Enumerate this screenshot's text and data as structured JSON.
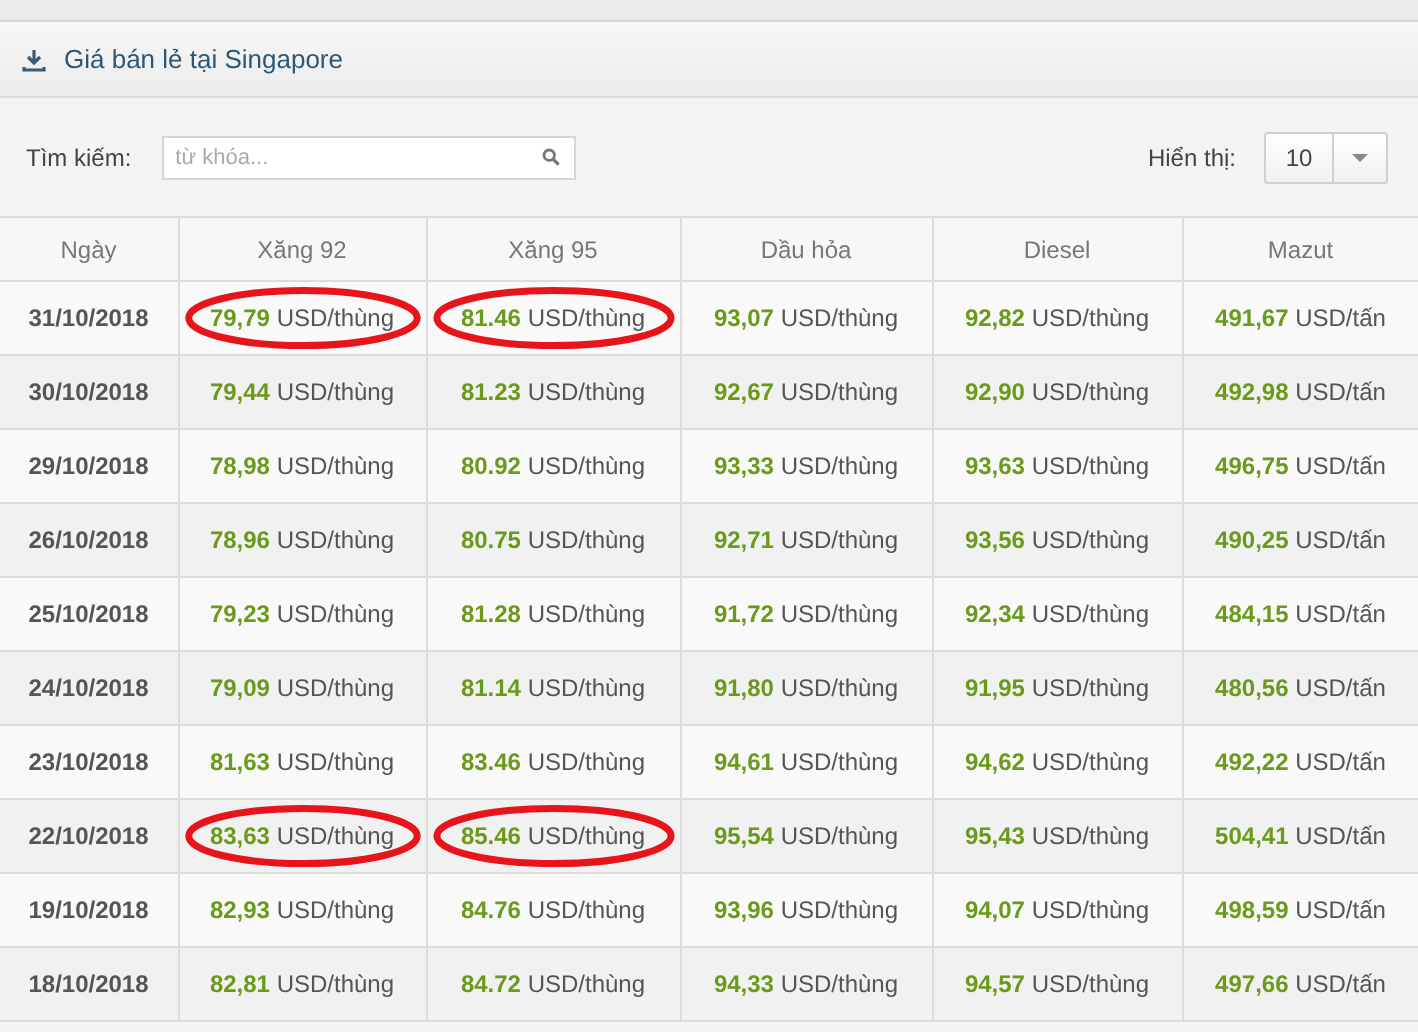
{
  "panel": {
    "title": "Giá bán lẻ tại Singapore"
  },
  "toolbar": {
    "search_label": "Tìm kiếm:",
    "search_placeholder": "từ khóa...",
    "page_size_label": "Hiển thị:",
    "page_size": "10"
  },
  "table": {
    "columns": [
      "Ngày",
      "Xăng 92",
      "Xăng 95",
      "Dầu hỏa",
      "Diesel",
      "Mazut"
    ],
    "rows": [
      {
        "cells": [
          {
            "kind": "date",
            "value": "31/10/2018"
          },
          {
            "kind": "price",
            "value": "79,79",
            "unit": "USD/thùng",
            "circled": true
          },
          {
            "kind": "price",
            "value": "81.46",
            "unit": "USD/thùng",
            "circled": true
          },
          {
            "kind": "price",
            "value": "93,07",
            "unit": "USD/thùng",
            "circled": false
          },
          {
            "kind": "price",
            "value": "92,82",
            "unit": "USD/thùng",
            "circled": false
          },
          {
            "kind": "price",
            "value": "491,67",
            "unit": "USD/tấn",
            "circled": false
          }
        ]
      },
      {
        "cells": [
          {
            "kind": "date",
            "value": "30/10/2018"
          },
          {
            "kind": "price",
            "value": "79,44",
            "unit": "USD/thùng",
            "circled": false
          },
          {
            "kind": "price",
            "value": "81.23",
            "unit": "USD/thùng",
            "circled": false
          },
          {
            "kind": "price",
            "value": "92,67",
            "unit": "USD/thùng",
            "circled": false
          },
          {
            "kind": "price",
            "value": "92,90",
            "unit": "USD/thùng",
            "circled": false
          },
          {
            "kind": "price",
            "value": "492,98",
            "unit": "USD/tấn",
            "circled": false
          }
        ]
      },
      {
        "cells": [
          {
            "kind": "date",
            "value": "29/10/2018"
          },
          {
            "kind": "price",
            "value": "78,98",
            "unit": "USD/thùng",
            "circled": false
          },
          {
            "kind": "price",
            "value": "80.92",
            "unit": "USD/thùng",
            "circled": false
          },
          {
            "kind": "price",
            "value": "93,33",
            "unit": "USD/thùng",
            "circled": false
          },
          {
            "kind": "price",
            "value": "93,63",
            "unit": "USD/thùng",
            "circled": false
          },
          {
            "kind": "price",
            "value": "496,75",
            "unit": "USD/tấn",
            "circled": false
          }
        ]
      },
      {
        "cells": [
          {
            "kind": "date",
            "value": "26/10/2018"
          },
          {
            "kind": "price",
            "value": "78,96",
            "unit": "USD/thùng",
            "circled": false
          },
          {
            "kind": "price",
            "value": "80.75",
            "unit": "USD/thùng",
            "circled": false
          },
          {
            "kind": "price",
            "value": "92,71",
            "unit": "USD/thùng",
            "circled": false
          },
          {
            "kind": "price",
            "value": "93,56",
            "unit": "USD/thùng",
            "circled": false
          },
          {
            "kind": "price",
            "value": "490,25",
            "unit": "USD/tấn",
            "circled": false
          }
        ]
      },
      {
        "cells": [
          {
            "kind": "date",
            "value": "25/10/2018"
          },
          {
            "kind": "price",
            "value": "79,23",
            "unit": "USD/thùng",
            "circled": false
          },
          {
            "kind": "price",
            "value": "81.28",
            "unit": "USD/thùng",
            "circled": false
          },
          {
            "kind": "price",
            "value": "91,72",
            "unit": "USD/thùng",
            "circled": false
          },
          {
            "kind": "price",
            "value": "92,34",
            "unit": "USD/thùng",
            "circled": false
          },
          {
            "kind": "price",
            "value": "484,15",
            "unit": "USD/tấn",
            "circled": false
          }
        ]
      },
      {
        "cells": [
          {
            "kind": "date",
            "value": "24/10/2018"
          },
          {
            "kind": "price",
            "value": "79,09",
            "unit": "USD/thùng",
            "circled": false
          },
          {
            "kind": "price",
            "value": "81.14",
            "unit": "USD/thùng",
            "circled": false
          },
          {
            "kind": "price",
            "value": "91,80",
            "unit": "USD/thùng",
            "circled": false
          },
          {
            "kind": "price",
            "value": "91,95",
            "unit": "USD/thùng",
            "circled": false
          },
          {
            "kind": "price",
            "value": "480,56",
            "unit": "USD/tấn",
            "circled": false
          }
        ]
      },
      {
        "cells": [
          {
            "kind": "date",
            "value": "23/10/2018"
          },
          {
            "kind": "price",
            "value": "81,63",
            "unit": "USD/thùng",
            "circled": false
          },
          {
            "kind": "price",
            "value": "83.46",
            "unit": "USD/thùng",
            "circled": false
          },
          {
            "kind": "price",
            "value": "94,61",
            "unit": "USD/thùng",
            "circled": false
          },
          {
            "kind": "price",
            "value": "94,62",
            "unit": "USD/thùng",
            "circled": false
          },
          {
            "kind": "price",
            "value": "492,22",
            "unit": "USD/tấn",
            "circled": false
          }
        ]
      },
      {
        "cells": [
          {
            "kind": "date",
            "value": "22/10/2018"
          },
          {
            "kind": "price",
            "value": "83,63",
            "unit": "USD/thùng",
            "circled": true
          },
          {
            "kind": "price",
            "value": "85.46",
            "unit": "USD/thùng",
            "circled": true
          },
          {
            "kind": "price",
            "value": "95,54",
            "unit": "USD/thùng",
            "circled": false
          },
          {
            "kind": "price",
            "value": "95,43",
            "unit": "USD/thùng",
            "circled": false
          },
          {
            "kind": "price",
            "value": "504,41",
            "unit": "USD/tấn",
            "circled": false
          }
        ]
      },
      {
        "cells": [
          {
            "kind": "date",
            "value": "19/10/2018"
          },
          {
            "kind": "price",
            "value": "82,93",
            "unit": "USD/thùng",
            "circled": false
          },
          {
            "kind": "price",
            "value": "84.76",
            "unit": "USD/thùng",
            "circled": false
          },
          {
            "kind": "price",
            "value": "93,96",
            "unit": "USD/thùng",
            "circled": false
          },
          {
            "kind": "price",
            "value": "94,07",
            "unit": "USD/thùng",
            "circled": false
          },
          {
            "kind": "price",
            "value": "498,59",
            "unit": "USD/tấn",
            "circled": false
          }
        ]
      },
      {
        "cells": [
          {
            "kind": "date",
            "value": "18/10/2018"
          },
          {
            "kind": "price",
            "value": "82,81",
            "unit": "USD/thùng",
            "circled": false
          },
          {
            "kind": "price",
            "value": "84.72",
            "unit": "USD/thùng",
            "circled": false
          },
          {
            "kind": "price",
            "value": "94,33",
            "unit": "USD/thùng",
            "circled": false
          },
          {
            "kind": "price",
            "value": "94,57",
            "unit": "USD/thùng",
            "circled": false
          },
          {
            "kind": "price",
            "value": "497,66",
            "unit": "USD/tấn",
            "circled": false
          }
        ]
      }
    ]
  }
}
